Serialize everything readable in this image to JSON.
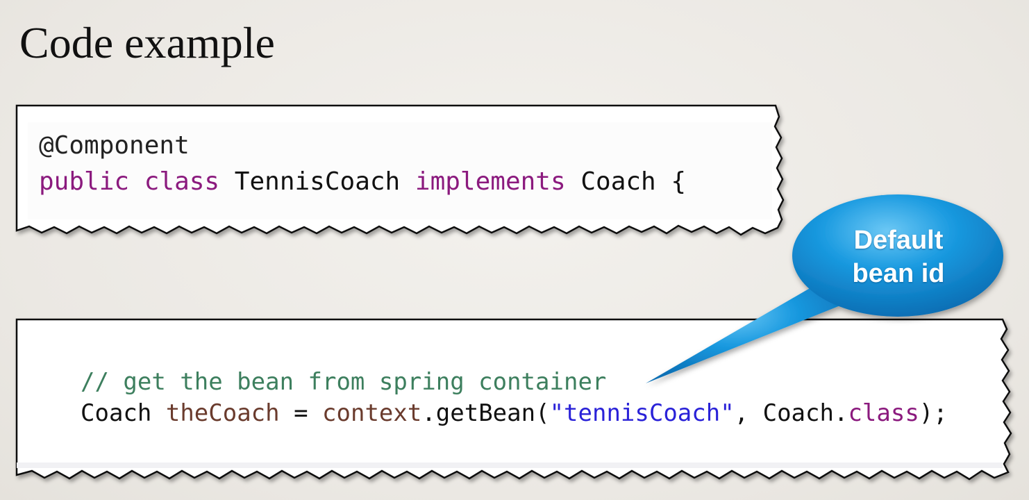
{
  "slide": {
    "title": "Code example"
  },
  "snippet1": {
    "line1": "@Component",
    "line2_kw1": "public",
    "line2_kw2": "class",
    "line2_name": "TennisCoach",
    "line2_kw3": "implements",
    "line2_iface": "Coach {"
  },
  "snippet2": {
    "comment": "// get the bean from spring container",
    "type": "Coach",
    "var": "theCoach",
    "eq": " = ",
    "ctx": "context",
    "call": ".getBean(",
    "str": "\"tennisCoach\"",
    "comma": ", Coach.",
    "cls": "class",
    "end": ");"
  },
  "callout": {
    "line1": "Default",
    "line2": "bean id",
    "color": "#1a9ae0"
  }
}
